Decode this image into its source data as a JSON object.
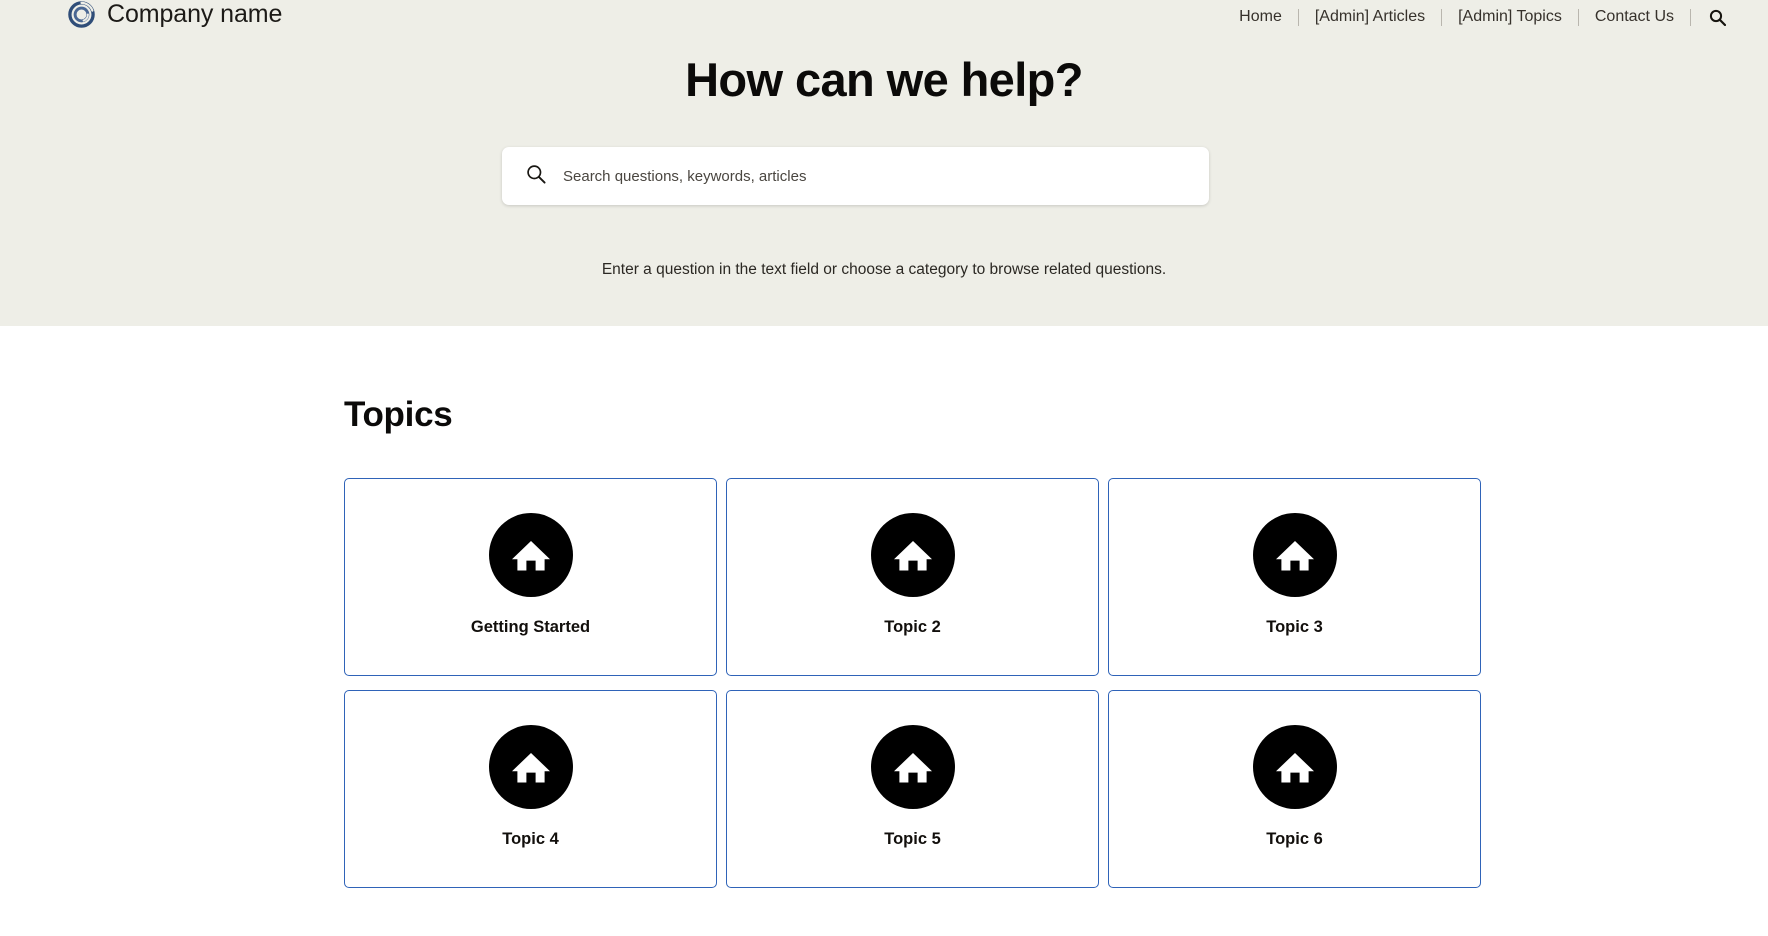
{
  "header": {
    "brand": {
      "logo_icon": "spiral-ring-logo-icon",
      "name": "Company name",
      "logo_color": "#2f4d78"
    },
    "nav": {
      "items": [
        {
          "label": "Home"
        },
        {
          "label": "[Admin] Articles"
        },
        {
          "label": "[Admin] Topics"
        },
        {
          "label": "Contact Us"
        }
      ],
      "search_icon": "search-icon"
    }
  },
  "hero": {
    "title": "How can we help?",
    "search": {
      "icon": "search-icon",
      "value": "",
      "placeholder": "Search questions, keywords, articles"
    },
    "subtitle": "Enter a question in the text field or choose a category to browse related questions.",
    "background_color": "#eeeee7"
  },
  "topics": {
    "heading": "Topics",
    "card_border_color": "#2f63b8",
    "icon_badge_color": "#000000",
    "cards": [
      {
        "label": "Getting Started",
        "icon": "home-icon"
      },
      {
        "label": "Topic 2",
        "icon": "home-icon"
      },
      {
        "label": "Topic 3",
        "icon": "home-icon"
      },
      {
        "label": "Topic 4",
        "icon": "home-icon"
      },
      {
        "label": "Topic 5",
        "icon": "home-icon"
      },
      {
        "label": "Topic 6",
        "icon": "home-icon"
      }
    ]
  }
}
